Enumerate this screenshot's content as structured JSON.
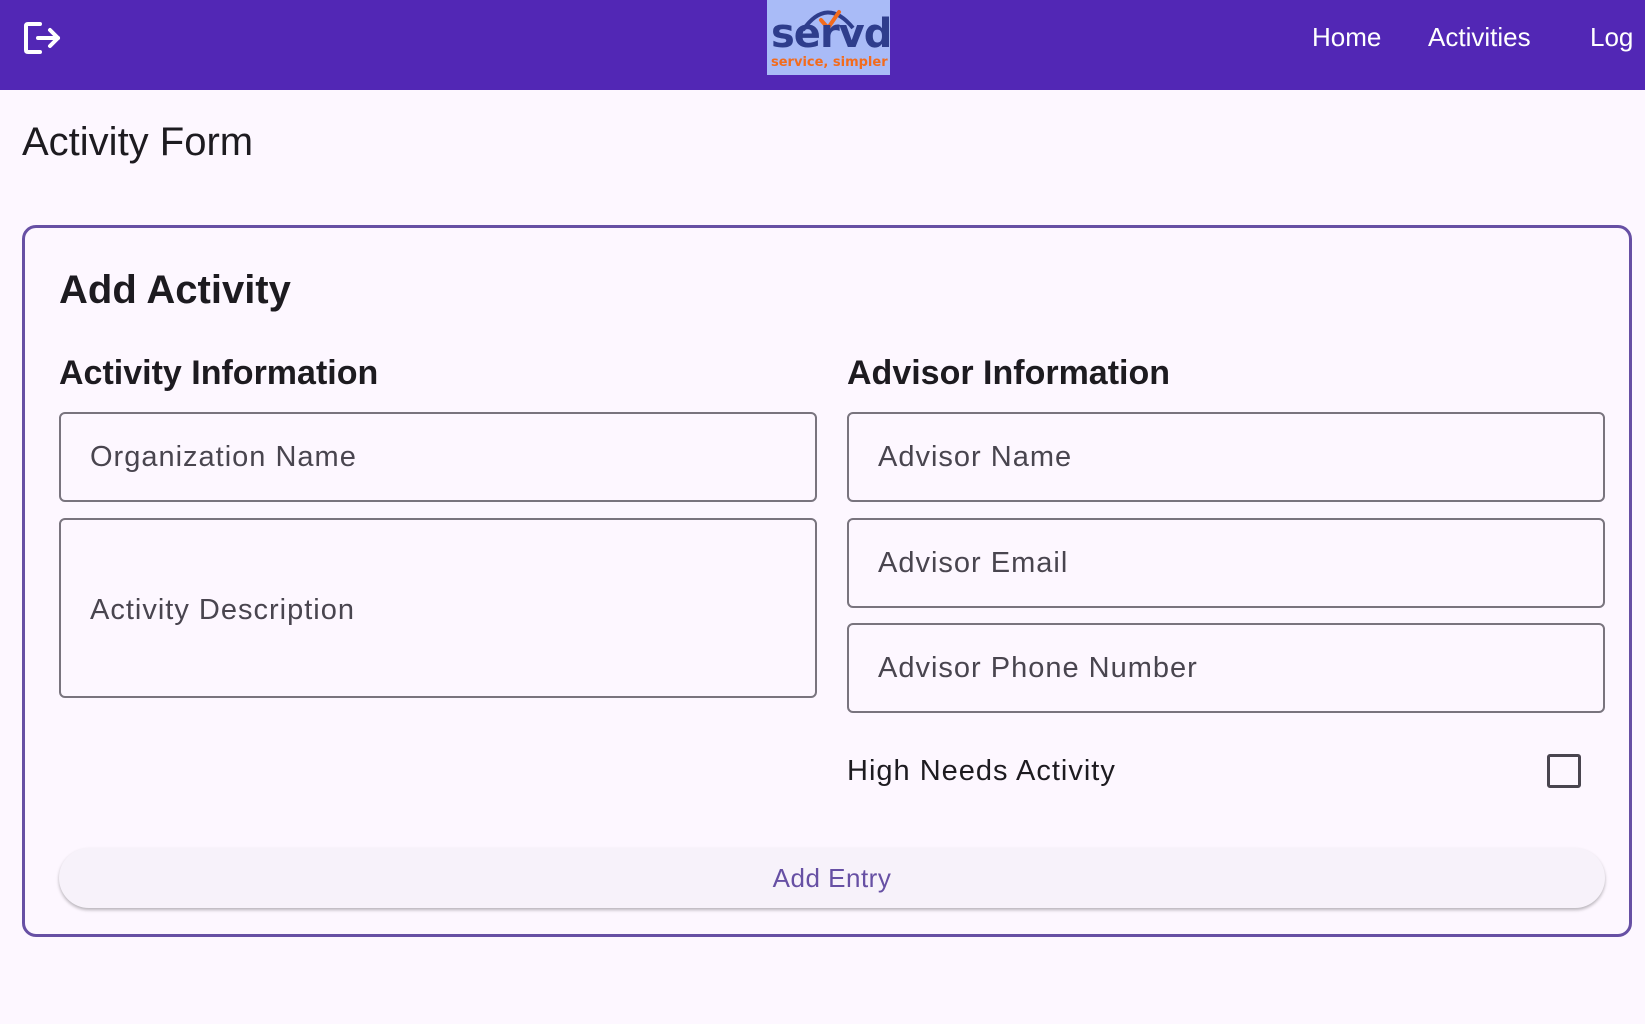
{
  "app": {
    "logo": {
      "wordmark": "servd",
      "tagline": "service, simpler"
    },
    "nav": [
      {
        "label": "Home"
      },
      {
        "label": "Activities"
      },
      {
        "label": "Log"
      }
    ]
  },
  "page": {
    "title": "Activity Form"
  },
  "form": {
    "title": "Add Activity",
    "activity_section": {
      "title": "Activity Information",
      "organization_name": {
        "placeholder": "Organization Name",
        "value": ""
      },
      "activity_description": {
        "placeholder": "Activity Description",
        "value": ""
      }
    },
    "advisor_section": {
      "title": "Advisor Information",
      "advisor_name": {
        "placeholder": "Advisor Name",
        "value": ""
      },
      "advisor_email": {
        "placeholder": "Advisor Email",
        "value": ""
      },
      "advisor_phone": {
        "placeholder": "Advisor Phone Number",
        "value": ""
      },
      "high_needs": {
        "label": "High Needs Activity",
        "checked": false
      }
    },
    "submit_label": "Add Entry"
  },
  "colors": {
    "app_bar": "#5227b5",
    "accent": "#6750a4",
    "background": "#fdf7ff",
    "logo_blue": "#2e3d8c",
    "logo_orange": "#f36b1c",
    "logo_background": "#a9bbf7"
  },
  "icons": {
    "logout": "logout-icon",
    "checkbox": "checkbox-unchecked-icon"
  }
}
